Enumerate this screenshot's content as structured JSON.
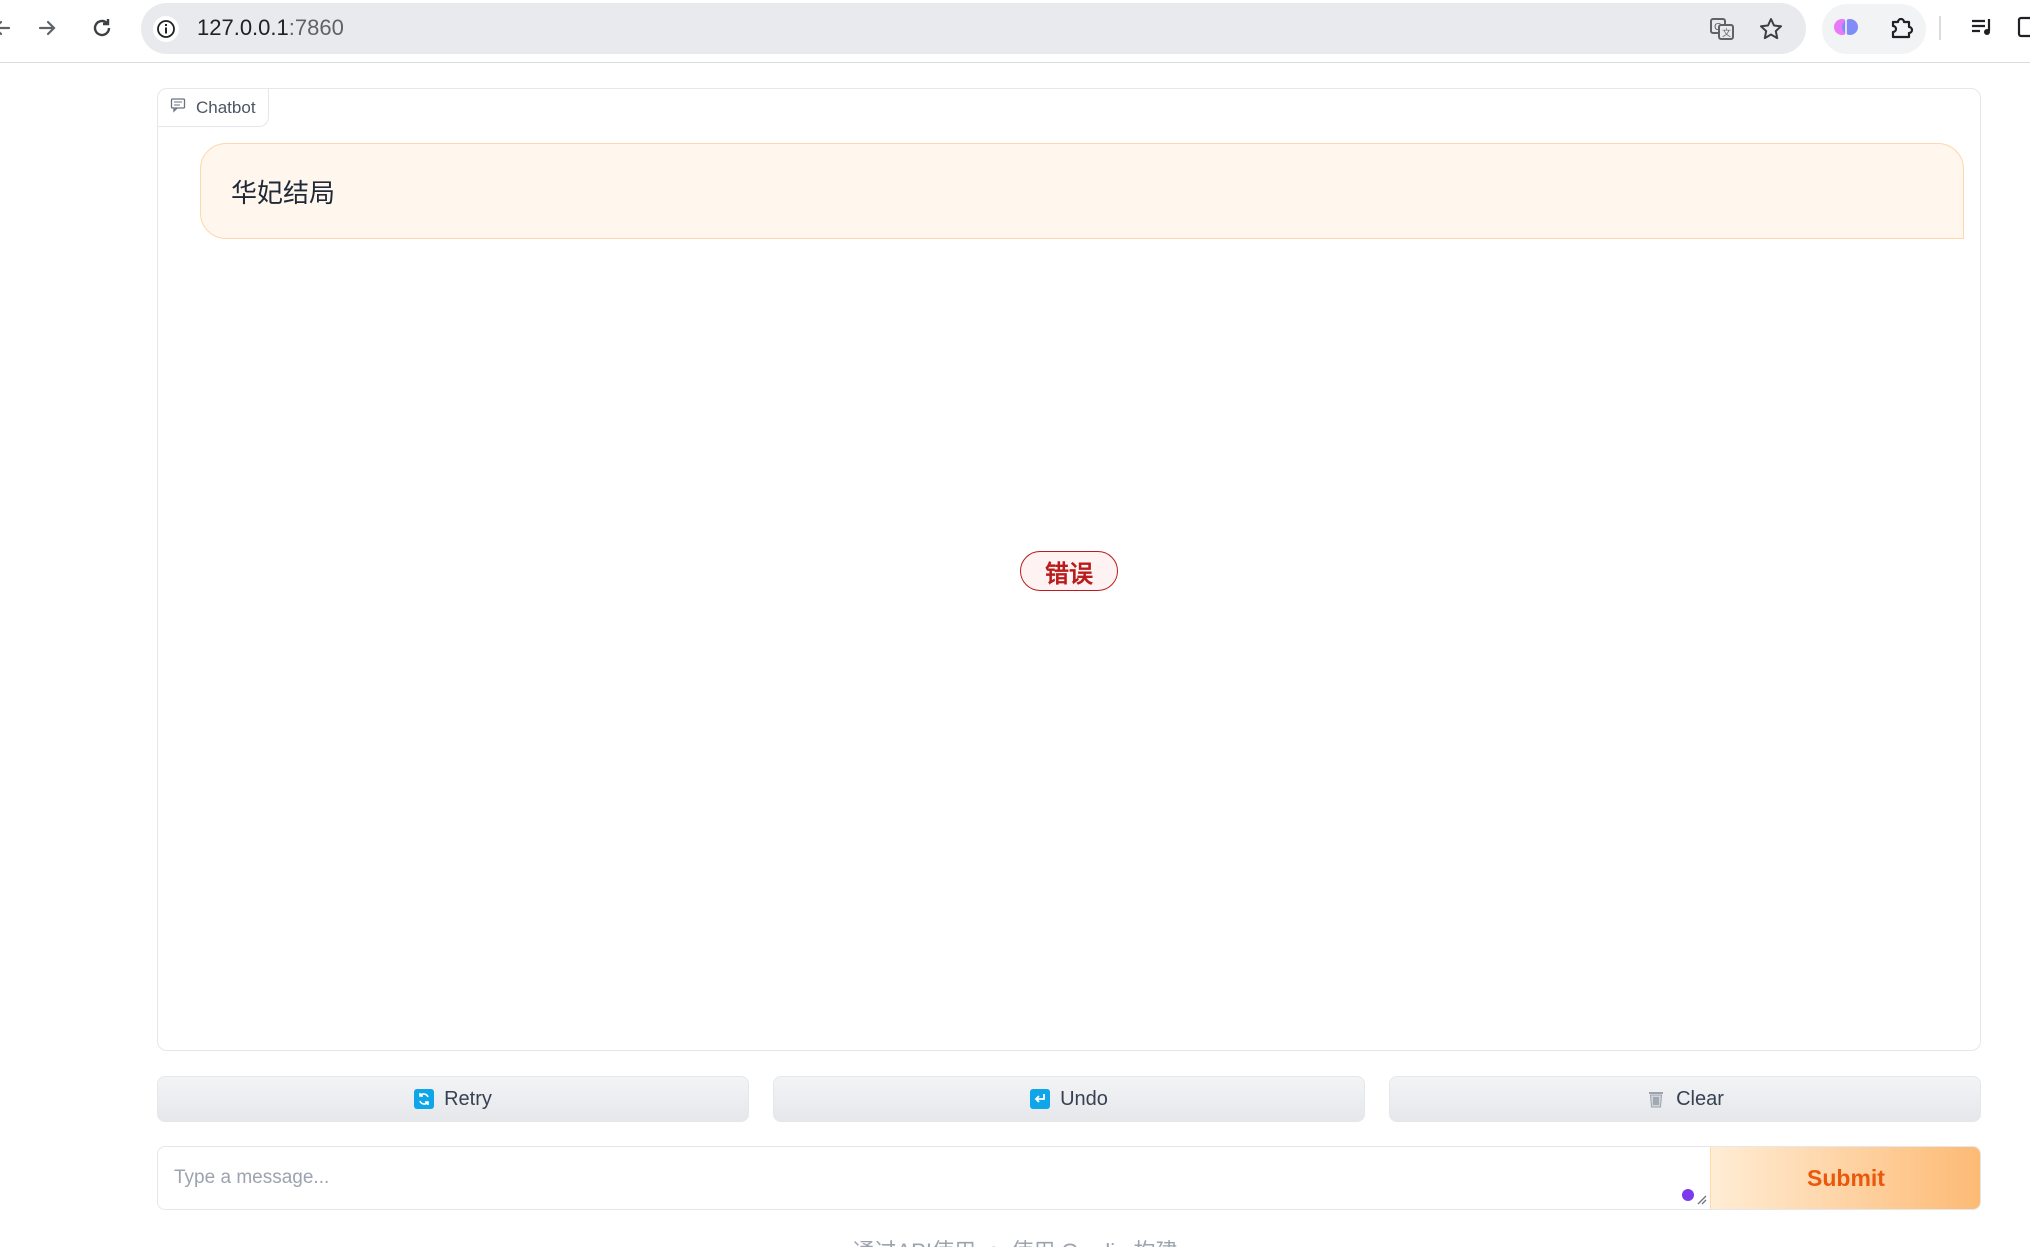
{
  "browser": {
    "url_host": "127.0.0.1",
    "url_port": ":7860"
  },
  "chatbot": {
    "label": "Chatbot",
    "user_message": "华妃结局",
    "error_badge": "错误"
  },
  "actions": {
    "retry_label": "Retry",
    "undo_label": "Undo",
    "clear_label": "Clear"
  },
  "input": {
    "placeholder": "Type a message...",
    "value": "",
    "submit_label": "Submit"
  },
  "footer": {
    "api_text": "通过API使用",
    "built_text": "使用 Gradio 构建"
  },
  "colors": {
    "accent": "#ea580c",
    "user_bubble": "#fff7ed",
    "error": "#b91c1c"
  }
}
